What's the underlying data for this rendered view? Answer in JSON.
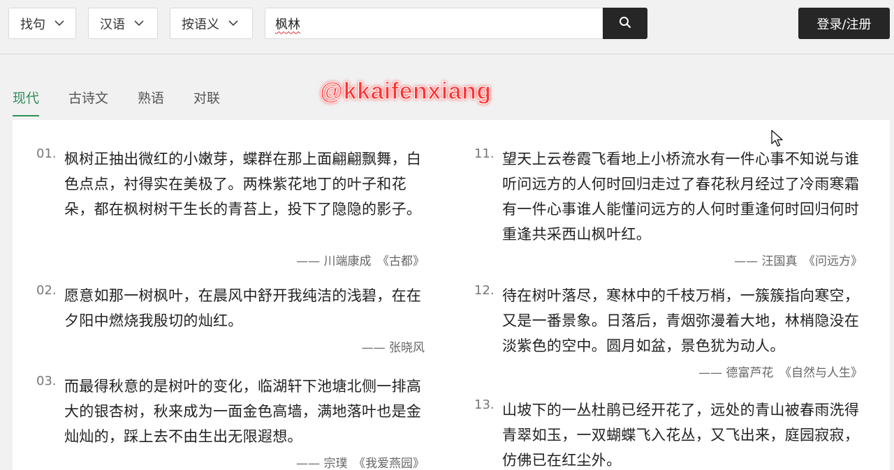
{
  "header": {
    "filters": [
      "找句",
      "汉语",
      "按语义"
    ],
    "search": {
      "value": "枫林"
    },
    "login_label": "登录/注册"
  },
  "tabs": [
    "现代",
    "古诗文",
    "熟语",
    "对联"
  ],
  "watermark": "@kkaifenxiang",
  "results_left": [
    {
      "num": "01.",
      "text": "枫树正抽出微红的小嫩芽，蝶群在那上面翩翩飘舞，白色点点，衬得实在美极了。两株紫花地丁的叶子和花朵，都在枫树树干生长的青苔上，投下了隐隐的影子。",
      "source": "—— 川端康成　《古都》"
    },
    {
      "num": "02.",
      "text": "愿意如那一树枫叶，在晨风中舒开我纯洁的浅碧，在在夕阳中燃烧我殷切的灿红。",
      "source": "—— 张晓风"
    },
    {
      "num": "03.",
      "text": "而最得秋意的是树叶的变化，临湖轩下池塘北侧一排高大的银杏树，秋来成为一面金色高墙，满地落叶也是金灿灿的，踩上去不由生出无限遐想。",
      "source": "—— 宗璞　《我爱燕园》"
    }
  ],
  "results_right": [
    {
      "num": "11.",
      "text": "望天上云卷霞飞看地上小桥流水有一件心事不知说与谁听问远方的人何时回归走过了春花秋月经过了冷雨寒霜有一件心事谁人能懂问远方的人何时重逢何时回归何时重逢共采西山枫叶红。",
      "source": "—— 汪国真　《问远方》"
    },
    {
      "num": "12.",
      "text": "待在树叶落尽，寒林中的千枝万梢，一簇簇指向寒空，又是一番景象。日落后，青烟弥漫着大地，林梢隐没在淡紫色的空中。圆月如盆，景色犹为动人。",
      "source": "—— 德富芦花　《自然与人生》"
    },
    {
      "num": "13.",
      "text": "山坡下的一丛杜鹃已经开花了，远处的青山被春雨洗得青翠如玉，一双蝴蝶飞入花丛，又飞出来，庭园寂寂，仿佛已在红尘外。",
      "source": ""
    }
  ],
  "colors": {
    "accent": "#2f8f5b",
    "dark_button": "#262626",
    "watermark": "#ff3333"
  }
}
